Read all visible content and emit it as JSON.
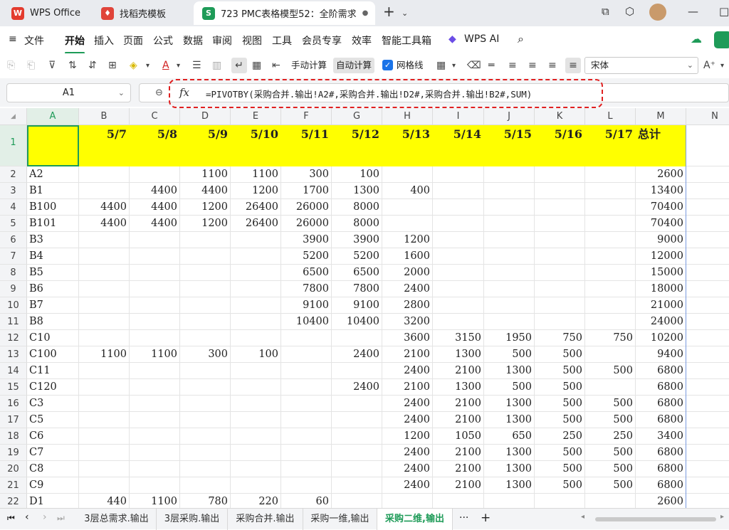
{
  "tabs": [
    {
      "label": "WPS Office",
      "icon": "wps-logo-icon"
    },
    {
      "label": "找稻壳模板",
      "icon": "docer-icon"
    },
    {
      "label": "723 PMC表格模型52：全阶需求",
      "icon": "spreadsheet-icon"
    }
  ],
  "new_tab": "+",
  "menu": [
    "文件",
    "开始",
    "插入",
    "页面",
    "公式",
    "数据",
    "审阅",
    "视图",
    "工具",
    "会员专享",
    "效率",
    "智能工具箱",
    "WPS AI"
  ],
  "toolbar": {
    "manual_calc": "手动计算",
    "auto_calc": "自动计算",
    "gridlines": "网格线",
    "font_name": "宋体"
  },
  "formula_bar": {
    "cell_ref": "A1",
    "fx": "fx",
    "formula": "=PIVOTBY(采购合并.输出!A2#,采购合并.输出!D2#,采购合并.输出!B2#,SUM)"
  },
  "columns": [
    "A",
    "B",
    "C",
    "D",
    "E",
    "F",
    "G",
    "H",
    "I",
    "J",
    "K",
    "L",
    "M",
    "N"
  ],
  "row_numbers": [
    "1",
    "2",
    "3",
    "4",
    "5",
    "6",
    "7",
    "8",
    "9",
    "10",
    "11",
    "12",
    "13",
    "14",
    "15",
    "16",
    "17",
    "18",
    "19",
    "20",
    "21",
    "22"
  ],
  "header_row": [
    "",
    "5/7",
    "5/8",
    "5/9",
    "5/10",
    "5/11",
    "5/12",
    "5/13",
    "5/14",
    "5/15",
    "5/16",
    "5/17",
    "总计"
  ],
  "rows": [
    [
      "A2",
      "",
      "",
      "1100",
      "1100",
      "300",
      "100",
      "",
      "",
      "",
      "",
      "",
      "2600"
    ],
    [
      "B1",
      "",
      "4400",
      "4400",
      "1200",
      "1700",
      "1300",
      "400",
      "",
      "",
      "",
      "",
      "13400"
    ],
    [
      "B100",
      "4400",
      "4400",
      "1200",
      "26400",
      "26000",
      "8000",
      "",
      "",
      "",
      "",
      "",
      "70400"
    ],
    [
      "B101",
      "4400",
      "4400",
      "1200",
      "26400",
      "26000",
      "8000",
      "",
      "",
      "",
      "",
      "",
      "70400"
    ],
    [
      "B3",
      "",
      "",
      "",
      "",
      "3900",
      "3900",
      "1200",
      "",
      "",
      "",
      "",
      "9000"
    ],
    [
      "B4",
      "",
      "",
      "",
      "",
      "5200",
      "5200",
      "1600",
      "",
      "",
      "",
      "",
      "12000"
    ],
    [
      "B5",
      "",
      "",
      "",
      "",
      "6500",
      "6500",
      "2000",
      "",
      "",
      "",
      "",
      "15000"
    ],
    [
      "B6",
      "",
      "",
      "",
      "",
      "7800",
      "7800",
      "2400",
      "",
      "",
      "",
      "",
      "18000"
    ],
    [
      "B7",
      "",
      "",
      "",
      "",
      "9100",
      "9100",
      "2800",
      "",
      "",
      "",
      "",
      "21000"
    ],
    [
      "B8",
      "",
      "",
      "",
      "",
      "10400",
      "10400",
      "3200",
      "",
      "",
      "",
      "",
      "24000"
    ],
    [
      "C10",
      "",
      "",
      "",
      "",
      "",
      "",
      "3600",
      "3150",
      "1950",
      "750",
      "750",
      "10200"
    ],
    [
      "C100",
      "1100",
      "1100",
      "300",
      "100",
      "",
      "2400",
      "2100",
      "1300",
      "500",
      "500",
      "",
      "9400"
    ],
    [
      "C11",
      "",
      "",
      "",
      "",
      "",
      "",
      "2400",
      "2100",
      "1300",
      "500",
      "500",
      "6800"
    ],
    [
      "C120",
      "",
      "",
      "",
      "",
      "",
      "2400",
      "2100",
      "1300",
      "500",
      "500",
      "",
      "6800"
    ],
    [
      "C3",
      "",
      "",
      "",
      "",
      "",
      "",
      "2400",
      "2100",
      "1300",
      "500",
      "500",
      "6800"
    ],
    [
      "C5",
      "",
      "",
      "",
      "",
      "",
      "",
      "2400",
      "2100",
      "1300",
      "500",
      "500",
      "6800"
    ],
    [
      "C6",
      "",
      "",
      "",
      "",
      "",
      "",
      "1200",
      "1050",
      "650",
      "250",
      "250",
      "3400"
    ],
    [
      "C7",
      "",
      "",
      "",
      "",
      "",
      "",
      "2400",
      "2100",
      "1300",
      "500",
      "500",
      "6800"
    ],
    [
      "C8",
      "",
      "",
      "",
      "",
      "",
      "",
      "2400",
      "2100",
      "1300",
      "500",
      "500",
      "6800"
    ],
    [
      "C9",
      "",
      "",
      "",
      "",
      "",
      "",
      "2400",
      "2100",
      "1300",
      "500",
      "500",
      "6800"
    ],
    [
      "D1",
      "440",
      "1100",
      "780",
      "220",
      "60",
      "",
      "",
      "",
      "",
      "",
      "",
      "2600"
    ]
  ],
  "sheet_tabs": [
    "3层总需求.输出",
    "3层采购.输出",
    "采购合并.输出",
    "采购一维,输出",
    "采购二维,输出"
  ],
  "active_sheet": "采购二维,输出",
  "more_sheets": "···",
  "add_sheet": "+",
  "colors": {
    "accent": "#1e9b58",
    "highlight": "#ffff00",
    "annotation": "#e02020"
  }
}
